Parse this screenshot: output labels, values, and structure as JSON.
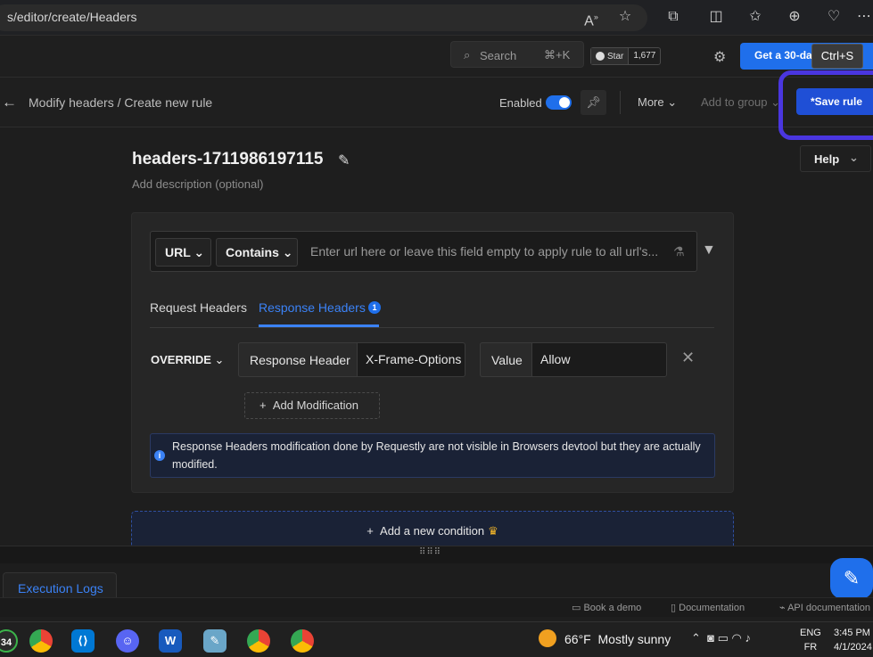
{
  "browser": {
    "url": "s/editor/create/Headers",
    "tooltip": "Ctrl+S"
  },
  "app": {
    "search_label": "Search",
    "search_shortcut": "⌘+K",
    "github_star_label": "Star",
    "github_star_count": "1,677",
    "trial_label": "Get a 30-day free trial"
  },
  "rulebar": {
    "breadcrumb": "Modify headers / Create new rule",
    "enabled_label": "Enabled",
    "more_label": "More",
    "add_group_label": "Add to group",
    "save_label": "*Save rule"
  },
  "rule": {
    "name": "headers-1711986197115",
    "description_placeholder": "Add description (optional)",
    "help_label": "Help"
  },
  "condition": {
    "field": "URL",
    "operator": "Contains",
    "url_placeholder": "Enter url here or leave this field empty to apply rule to all url's..."
  },
  "tabs": [
    {
      "label": "Request Headers"
    },
    {
      "label": "Response Headers",
      "count": "1"
    }
  ],
  "modification": {
    "type": "OVERRIDE",
    "header_label": "Response Header",
    "header_name": "X-Frame-Options",
    "value_label": "Value",
    "value": "Allow",
    "add_label": "Add Modification"
  },
  "notice": "Response Headers modification done by Requestly are not visible in Browsers devtool but they are actually modified.",
  "add_condition_label": "Add a new condition",
  "bottom": {
    "exec_logs": "Execution Logs"
  },
  "footer": {
    "book_demo": "Book a demo",
    "documentation": "Documentation",
    "api_docs": "API documentation"
  },
  "taskbar": {
    "badge": "34",
    "weather_temp": "66°F",
    "weather_text": "Mostly sunny",
    "lang_top": "ENG",
    "lang_bottom": "FR",
    "time": "3:45 PM",
    "date": "4/1/2024"
  },
  "colors": {
    "accent": "#1f6feb",
    "save_frame": "#4a36e0"
  }
}
